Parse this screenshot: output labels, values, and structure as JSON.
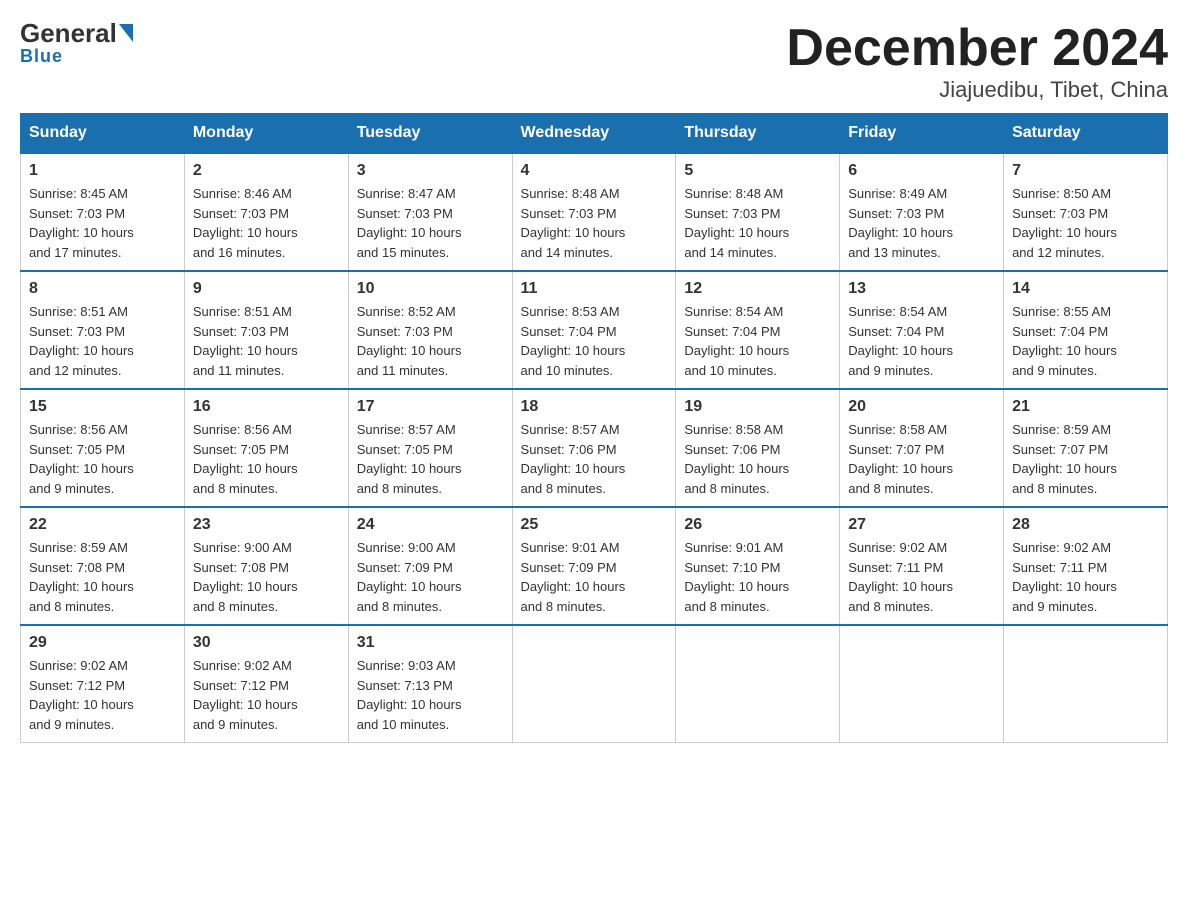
{
  "logo": {
    "general": "General",
    "blue": "Blue"
  },
  "title": "December 2024",
  "subtitle": "Jiajuedibu, Tibet, China",
  "days_of_week": [
    "Sunday",
    "Monday",
    "Tuesday",
    "Wednesday",
    "Thursday",
    "Friday",
    "Saturday"
  ],
  "weeks": [
    [
      {
        "day": "1",
        "sunrise": "8:45 AM",
        "sunset": "7:03 PM",
        "daylight": "10 hours and 17 minutes."
      },
      {
        "day": "2",
        "sunrise": "8:46 AM",
        "sunset": "7:03 PM",
        "daylight": "10 hours and 16 minutes."
      },
      {
        "day": "3",
        "sunrise": "8:47 AM",
        "sunset": "7:03 PM",
        "daylight": "10 hours and 15 minutes."
      },
      {
        "day": "4",
        "sunrise": "8:48 AM",
        "sunset": "7:03 PM",
        "daylight": "10 hours and 14 minutes."
      },
      {
        "day": "5",
        "sunrise": "8:48 AM",
        "sunset": "7:03 PM",
        "daylight": "10 hours and 14 minutes."
      },
      {
        "day": "6",
        "sunrise": "8:49 AM",
        "sunset": "7:03 PM",
        "daylight": "10 hours and 13 minutes."
      },
      {
        "day": "7",
        "sunrise": "8:50 AM",
        "sunset": "7:03 PM",
        "daylight": "10 hours and 12 minutes."
      }
    ],
    [
      {
        "day": "8",
        "sunrise": "8:51 AM",
        "sunset": "7:03 PM",
        "daylight": "10 hours and 12 minutes."
      },
      {
        "day": "9",
        "sunrise": "8:51 AM",
        "sunset": "7:03 PM",
        "daylight": "10 hours and 11 minutes."
      },
      {
        "day": "10",
        "sunrise": "8:52 AM",
        "sunset": "7:03 PM",
        "daylight": "10 hours and 11 minutes."
      },
      {
        "day": "11",
        "sunrise": "8:53 AM",
        "sunset": "7:04 PM",
        "daylight": "10 hours and 10 minutes."
      },
      {
        "day": "12",
        "sunrise": "8:54 AM",
        "sunset": "7:04 PM",
        "daylight": "10 hours and 10 minutes."
      },
      {
        "day": "13",
        "sunrise": "8:54 AM",
        "sunset": "7:04 PM",
        "daylight": "10 hours and 9 minutes."
      },
      {
        "day": "14",
        "sunrise": "8:55 AM",
        "sunset": "7:04 PM",
        "daylight": "10 hours and 9 minutes."
      }
    ],
    [
      {
        "day": "15",
        "sunrise": "8:56 AM",
        "sunset": "7:05 PM",
        "daylight": "10 hours and 9 minutes."
      },
      {
        "day": "16",
        "sunrise": "8:56 AM",
        "sunset": "7:05 PM",
        "daylight": "10 hours and 8 minutes."
      },
      {
        "day": "17",
        "sunrise": "8:57 AM",
        "sunset": "7:05 PM",
        "daylight": "10 hours and 8 minutes."
      },
      {
        "day": "18",
        "sunrise": "8:57 AM",
        "sunset": "7:06 PM",
        "daylight": "10 hours and 8 minutes."
      },
      {
        "day": "19",
        "sunrise": "8:58 AM",
        "sunset": "7:06 PM",
        "daylight": "10 hours and 8 minutes."
      },
      {
        "day": "20",
        "sunrise": "8:58 AM",
        "sunset": "7:07 PM",
        "daylight": "10 hours and 8 minutes."
      },
      {
        "day": "21",
        "sunrise": "8:59 AM",
        "sunset": "7:07 PM",
        "daylight": "10 hours and 8 minutes."
      }
    ],
    [
      {
        "day": "22",
        "sunrise": "8:59 AM",
        "sunset": "7:08 PM",
        "daylight": "10 hours and 8 minutes."
      },
      {
        "day": "23",
        "sunrise": "9:00 AM",
        "sunset": "7:08 PM",
        "daylight": "10 hours and 8 minutes."
      },
      {
        "day": "24",
        "sunrise": "9:00 AM",
        "sunset": "7:09 PM",
        "daylight": "10 hours and 8 minutes."
      },
      {
        "day": "25",
        "sunrise": "9:01 AM",
        "sunset": "7:09 PM",
        "daylight": "10 hours and 8 minutes."
      },
      {
        "day": "26",
        "sunrise": "9:01 AM",
        "sunset": "7:10 PM",
        "daylight": "10 hours and 8 minutes."
      },
      {
        "day": "27",
        "sunrise": "9:02 AM",
        "sunset": "7:11 PM",
        "daylight": "10 hours and 8 minutes."
      },
      {
        "day": "28",
        "sunrise": "9:02 AM",
        "sunset": "7:11 PM",
        "daylight": "10 hours and 9 minutes."
      }
    ],
    [
      {
        "day": "29",
        "sunrise": "9:02 AM",
        "sunset": "7:12 PM",
        "daylight": "10 hours and 9 minutes."
      },
      {
        "day": "30",
        "sunrise": "9:02 AM",
        "sunset": "7:12 PM",
        "daylight": "10 hours and 9 minutes."
      },
      {
        "day": "31",
        "sunrise": "9:03 AM",
        "sunset": "7:13 PM",
        "daylight": "10 hours and 10 minutes."
      },
      null,
      null,
      null,
      null
    ]
  ],
  "labels": {
    "sunrise": "Sunrise:",
    "sunset": "Sunset:",
    "daylight": "Daylight:"
  }
}
